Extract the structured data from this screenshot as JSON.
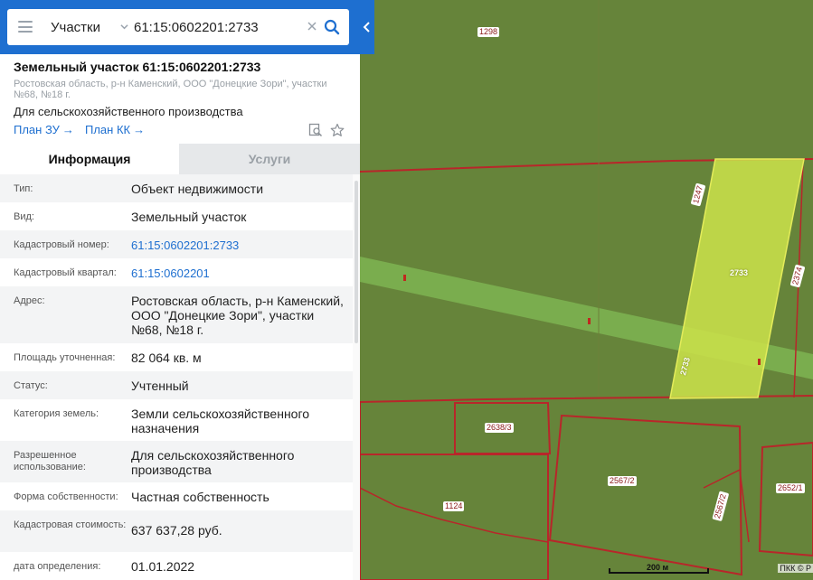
{
  "search": {
    "type_label": "Участки",
    "query": "61:15:0602201:2733"
  },
  "object": {
    "title": "Земельный участок 61:15:0602201:2733",
    "address": "Ростовская область, р-н Каменский, ООО \"Донецкие Зори\", участки №68, №18 г.",
    "purpose": "Для сельскохозяйственного производства",
    "plan_zu": "План ЗУ",
    "plan_kk": "План КК",
    "arrow": "→"
  },
  "tabs": {
    "info": "Информация",
    "services": "Услуги"
  },
  "info": [
    {
      "label": "Тип:",
      "value": "Объект недвижимости"
    },
    {
      "label": "Вид:",
      "value": "Земельный участок"
    },
    {
      "label": "Кадастровый номер:",
      "value": "61:15:0602201:2733"
    },
    {
      "label": "Кадастровый квартал:",
      "value": "61:15:0602201"
    },
    {
      "label": "Адрес:",
      "value": "Ростовская область, р-н Каменский, ООО \"Донецкие Зори\", участки №68, №18 г."
    },
    {
      "label": "Площадь уточненная:",
      "value": "82 064 кв. м"
    },
    {
      "label": "Статус:",
      "value": "Учтенный"
    },
    {
      "label": "Категория земель:",
      "value": "Земли сельскохозяйственного назначения"
    },
    {
      "label": "Разрешенное использование:",
      "value": "Для сельскохозяйственного производства"
    },
    {
      "label": "Форма собственности:",
      "value": "Частная собственность"
    },
    {
      "label": "Кадастровая стоимость:",
      "value": "637 637,28 руб."
    },
    {
      "label": "дата определения:",
      "value": "01.01.2022"
    }
  ],
  "map": {
    "parcel_labels": [
      "1298",
      "1247",
      "2733",
      "2374",
      "2733",
      "2638/3",
      "2567/2",
      "1124",
      "2567/2",
      "2652/1"
    ],
    "scale": "200 м",
    "attribution": "ПКК © Р"
  },
  "colors": {
    "accent": "#1e6fd0",
    "map_field": "#66843a",
    "parcel_border": "#b8262a",
    "selected_fill": "#c9e04a"
  }
}
